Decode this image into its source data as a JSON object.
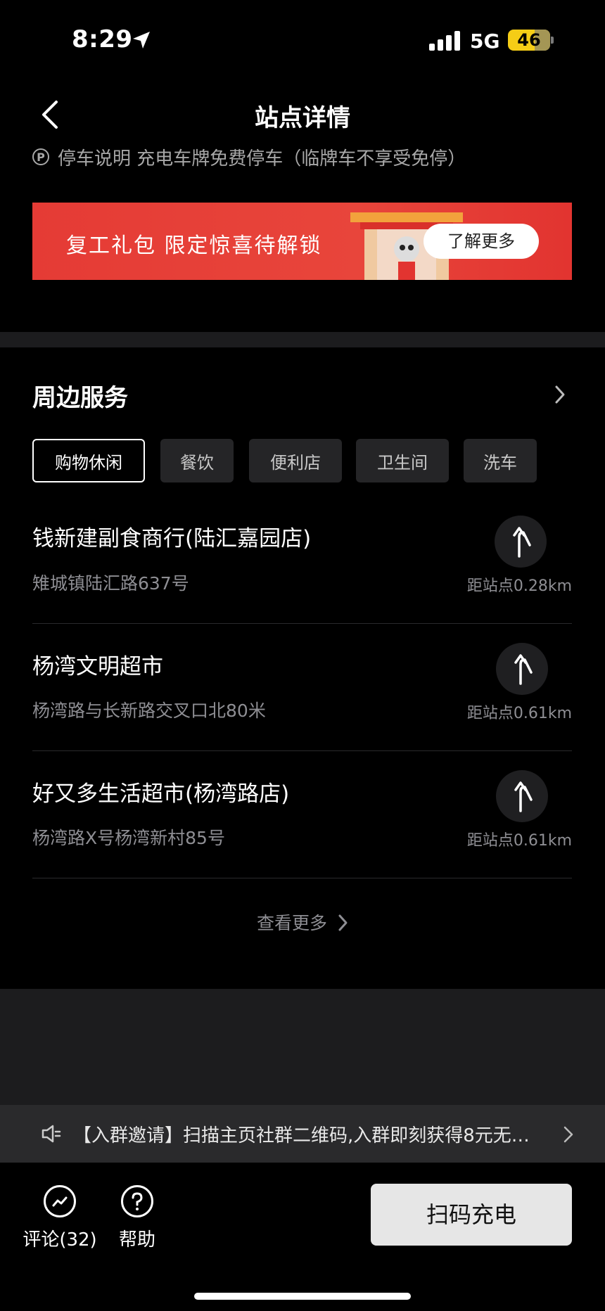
{
  "status_bar": {
    "time": "8:29",
    "network": "5G",
    "battery": "46"
  },
  "header": {
    "title": "站点详情"
  },
  "parking": {
    "icon": "P",
    "text": "停车说明 充电车牌免费停车（临牌车不享受免停）"
  },
  "banner": {
    "text": "复工礼包 限定惊喜待解锁",
    "button": "了解更多"
  },
  "nearby": {
    "title": "周边服务",
    "chips": [
      "购物休闲",
      "餐饮",
      "便利店",
      "卫生间",
      "洗车"
    ],
    "active_chip": "购物休闲",
    "items": [
      {
        "name": "钱新建副食商行(陆汇嘉园店)",
        "address": "雉城镇陆汇路637号",
        "distance": "距站点0.28km"
      },
      {
        "name": "杨湾文明超市",
        "address": "杨湾路与长新路交叉口北80米",
        "distance": "距站点0.61km"
      },
      {
        "name": "好又多生活超市(杨湾路店)",
        "address": "杨湾路X号杨湾新村85号",
        "distance": "距站点0.61km"
      }
    ],
    "more": "查看更多"
  },
  "notice": {
    "text": "【入群邀请】扫描主页社群二维码,入群即刻获得8元无…"
  },
  "bottom": {
    "comment_label": "评论(32)",
    "help_label": "帮助",
    "scan_button": "扫码充电"
  }
}
